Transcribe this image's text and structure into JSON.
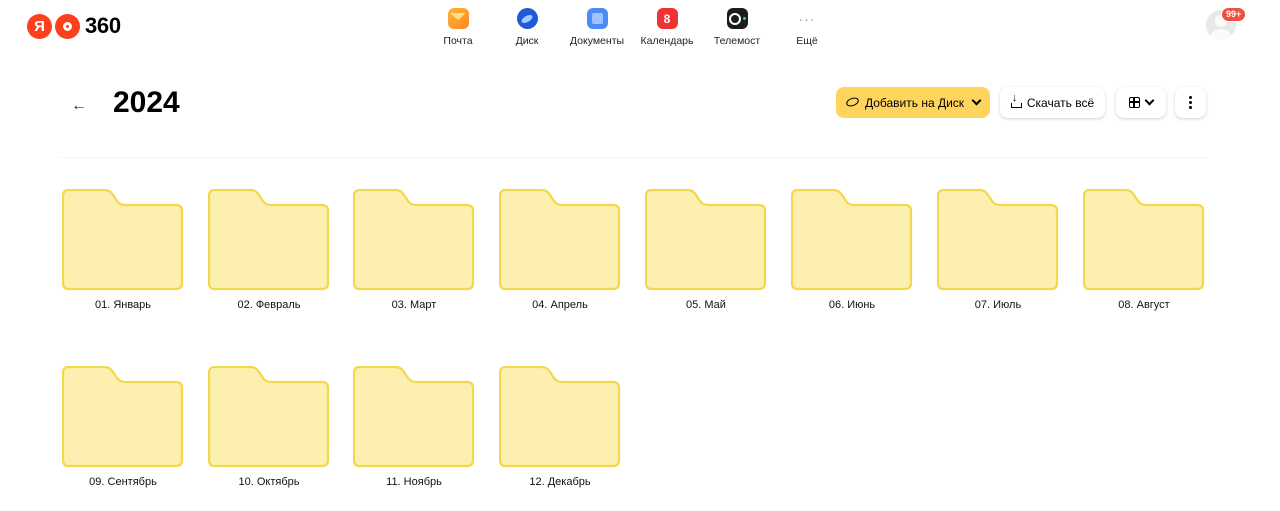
{
  "header": {
    "logo_text": "360",
    "logo_letter": "Я",
    "services": [
      {
        "label": "Почта",
        "icon": "mail-icon"
      },
      {
        "label": "Диск",
        "icon": "disk-icon"
      },
      {
        "label": "Документы",
        "icon": "documents-icon"
      },
      {
        "label": "Календарь",
        "icon": "calendar-icon",
        "icon_text": "8"
      },
      {
        "label": "Телемост",
        "icon": "telemost-icon"
      },
      {
        "label": "Ещё",
        "icon": "more-icon",
        "icon_text": "···"
      }
    ],
    "notifications_badge": "99+"
  },
  "titlebar": {
    "back_icon": "←",
    "title": "2024",
    "add_button": "Добавить на Диск",
    "download_button": "Скачать всё"
  },
  "folders": [
    {
      "name": "01. Январь"
    },
    {
      "name": "02. Февраль"
    },
    {
      "name": "03. Март"
    },
    {
      "name": "04. Апрель"
    },
    {
      "name": "05. Май"
    },
    {
      "name": "06. Июнь"
    },
    {
      "name": "07. Июль"
    },
    {
      "name": "08. Август"
    },
    {
      "name": "09. Сентябрь"
    },
    {
      "name": "10. Октябрь"
    },
    {
      "name": "11. Ноябрь"
    },
    {
      "name": "12. Декабрь"
    }
  ],
  "colors": {
    "accent_yellow": "#fed45c",
    "folder_fill": "#fcefb0",
    "folder_stroke": "#f2d84c",
    "badge_red": "#f0503f"
  }
}
